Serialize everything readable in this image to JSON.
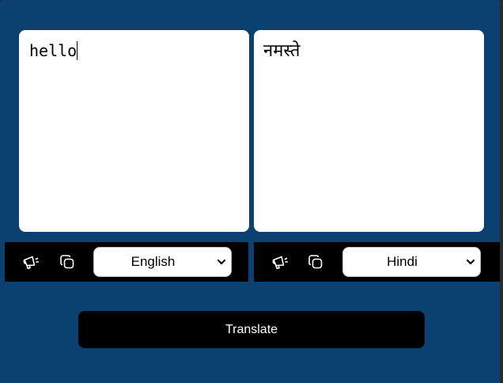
{
  "source": {
    "text": "hello",
    "language": "English"
  },
  "target": {
    "text": "नमस्ते",
    "language": "Hindi"
  },
  "icons": {
    "speak": "speaker-icon",
    "copy": "copy-icon",
    "dropdown": "chevron-down-icon"
  },
  "translate_button": {
    "label": "Translate"
  },
  "colors": {
    "background": "#0a4170",
    "panel": "#ffffff",
    "toolbar": "#000000",
    "button": "#000000",
    "button_text": "#ffffff"
  }
}
